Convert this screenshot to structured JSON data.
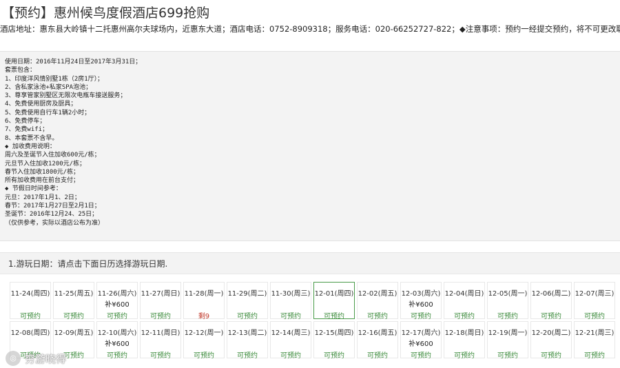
{
  "header": {
    "title": "【预约】惠州候鸟度假酒店699抢购",
    "address_line": "酒店地址：惠东县大岭镇十二托惠州高尔夫球场内，近惠东大道；酒店电话：0752-8909318；服务电话：020-66252727-822；◆注意事项：预约一经提交预约，将不可更改取消！"
  },
  "info": {
    "lines": [
      "使用日期：2016年11月24日至2017年3月31日；",
      "套票包含：",
      "1、印度洋风情别墅1栋（2房1厅）；",
      "2、含私家泳池+私家SPA泡池；",
      "3、尊享管家别墅区无限次电瓶车接送服务；",
      "4、免费使用厨房及厨具；",
      "5、免费使用自行车1辆2小时；",
      "6、免费停车；",
      "7、免费wifi；",
      "8、本套票不含早。",
      "◆ 加收费用说明：",
      "周六及圣诞节入住加收600元/栋；",
      "元旦节入住加收1200元/栋；",
      "春节入住加收1800元/栋；",
      "所有加收费用在前台支付；",
      "◆ 节假日时间参考：",
      "元旦：2017年1月1、2日；",
      "春节：2017年1月27日至2月1日；",
      "圣诞节：2016年12月24、25日；",
      "（仅供参考，实际以酒店公布为准）"
    ]
  },
  "step": {
    "label": "1.游玩日期：请点击下面日历选择游玩日期."
  },
  "calendar": {
    "rows": [
      [
        {
          "date": "11-24(周四)",
          "price": "",
          "status": "可预约"
        },
        {
          "date": "11-25(周五)",
          "price": "",
          "status": "可预约"
        },
        {
          "date": "11-26(周六)",
          "price": "补¥600",
          "status": "可预约"
        },
        {
          "date": "11-27(周日)",
          "price": "",
          "status": "可预约"
        },
        {
          "date": "11-28(周一)",
          "price": "",
          "status": "剩9"
        },
        {
          "date": "11-29(周二)",
          "price": "",
          "status": "可预约"
        },
        {
          "date": "11-30(周三)",
          "price": "",
          "status": "可预约"
        },
        {
          "date": "12-01(周四)",
          "price": "",
          "status": "可预约"
        },
        {
          "date": "12-02(周五)",
          "price": "",
          "status": "可预约"
        },
        {
          "date": "12-03(周六)",
          "price": "补¥600",
          "status": "可预约"
        },
        {
          "date": "12-04(周日)",
          "price": "",
          "status": "可预约"
        },
        {
          "date": "12-05(周一)",
          "price": "",
          "status": "可预约"
        },
        {
          "date": "12-06(周二)",
          "price": "",
          "status": "可预约"
        },
        {
          "date": "12-07(周三)",
          "price": "",
          "status": "可预约"
        }
      ],
      [
        {
          "date": "12-08(周四)",
          "price": "",
          "status": "可预约"
        },
        {
          "date": "12-09(周五)",
          "price": "",
          "status": "可预约"
        },
        {
          "date": "12-10(周六)",
          "price": "补¥600",
          "status": "可预约"
        },
        {
          "date": "12-11(周日)",
          "price": "",
          "status": "可预约"
        },
        {
          "date": "12-12(周一)",
          "price": "",
          "status": "可预约"
        },
        {
          "date": "12-13(周二)",
          "price": "",
          "status": "可预约"
        },
        {
          "date": "12-14(周三)",
          "price": "",
          "status": "可预约"
        },
        {
          "date": "12-15(周四)",
          "price": "",
          "status": "可预约"
        },
        {
          "date": "12-16(周五)",
          "price": "",
          "status": "可预约"
        },
        {
          "date": "12-17(周六)",
          "price": "补¥600",
          "status": "可预约"
        },
        {
          "date": "12-18(周日)",
          "price": "",
          "status": "可预约"
        },
        {
          "date": "12-19(周一)",
          "price": "",
          "status": "可预约"
        },
        {
          "date": "12-20(周二)",
          "price": "",
          "status": "可预约"
        },
        {
          "date": "12-21(周三)",
          "price": "",
          "status": "可预约"
        }
      ]
    ],
    "selected_date": "12-01(周四)"
  },
  "watermark": {
    "text": "穷游晓得",
    "icon": "swirl-logo-icon"
  },
  "colors": {
    "available": "#3a8a3a",
    "limited": "#c0392b",
    "selected_border": "#4a9b4a"
  }
}
